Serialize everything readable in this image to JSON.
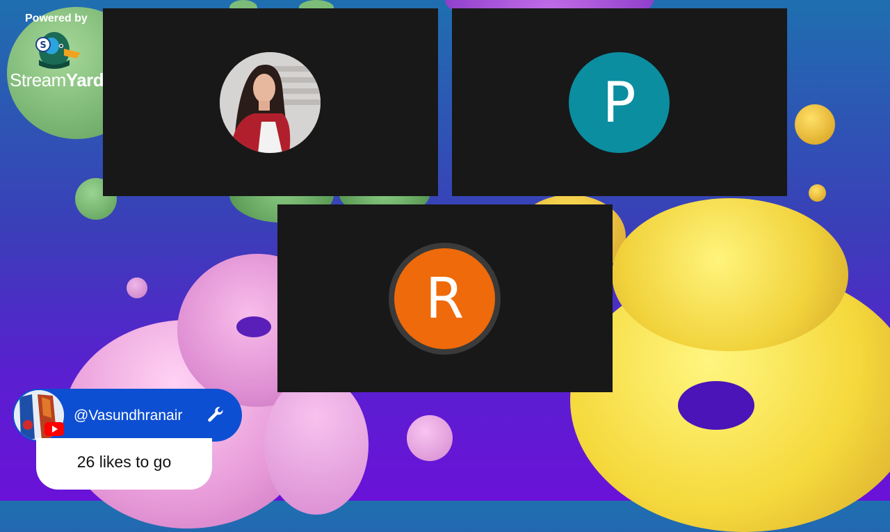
{
  "branding": {
    "powered_by": "Powered by",
    "logo_prefix": "Stream",
    "logo_suffix": "Yard"
  },
  "participants": [
    {
      "type": "photo",
      "avatar_icon": "user-photo"
    },
    {
      "type": "initial",
      "initial": "P",
      "color": "#0b8ea0"
    },
    {
      "type": "initial",
      "initial": "R",
      "color": "#ef6a0a"
    }
  ],
  "comment": {
    "username": "@Vasundhranair",
    "platform_icon": "youtube-icon",
    "badge_icon": "wrench-icon"
  },
  "likes_goal": {
    "text": "26 likes to go"
  }
}
